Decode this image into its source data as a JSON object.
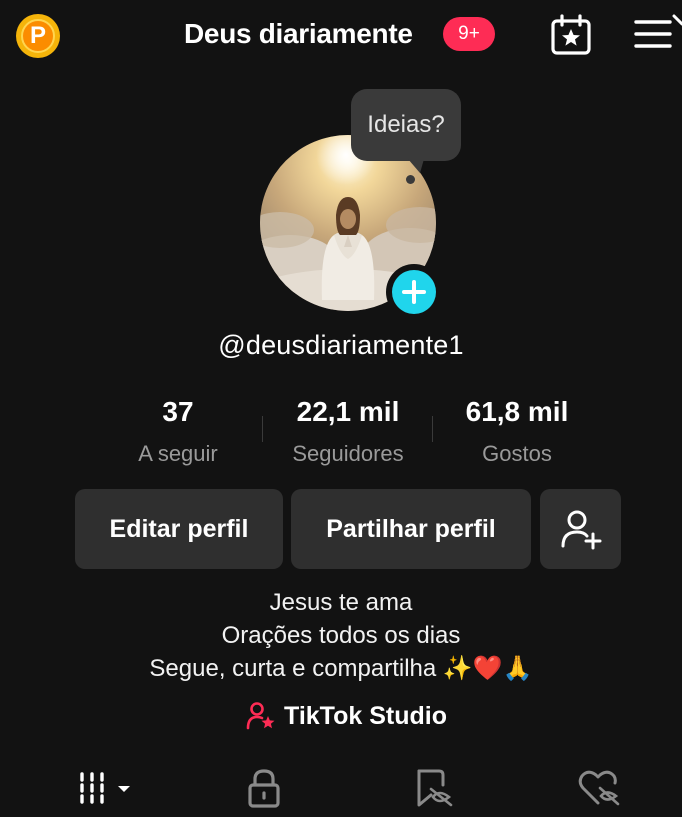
{
  "header": {
    "coin_letter": "P",
    "title": "Deus diariamente",
    "notification_badge": "9+"
  },
  "profile": {
    "bubble_text": "Ideias?",
    "username": "@deusdiariamente1"
  },
  "stats": [
    {
      "value": "37",
      "label": "A seguir"
    },
    {
      "value": "22,1 mil",
      "label": "Seguidores"
    },
    {
      "value": "61,8 mil",
      "label": "Gostos"
    }
  ],
  "actions": {
    "edit_label": "Editar perfil",
    "share_label": "Partilhar perfil",
    "add_friend_icon": "add-user-icon"
  },
  "bio": {
    "lines": [
      "Jesus te ama",
      "Orações todos os dias",
      "Segue, curta e compartilha"
    ],
    "emojis": "✨❤️🙏"
  },
  "studio": {
    "label": "TikTok Studio"
  },
  "tabs": [
    {
      "icon": "grid-icon"
    },
    {
      "icon": "lock-icon"
    },
    {
      "icon": "repost-icon"
    },
    {
      "icon": "liked-heart-icon"
    }
  ],
  "colors": {
    "background": "#121212",
    "accent_red": "#fe2c55",
    "accent_cyan": "#20d5ec",
    "button_bg": "#2f2f2f",
    "coin": "#f5b40a"
  }
}
